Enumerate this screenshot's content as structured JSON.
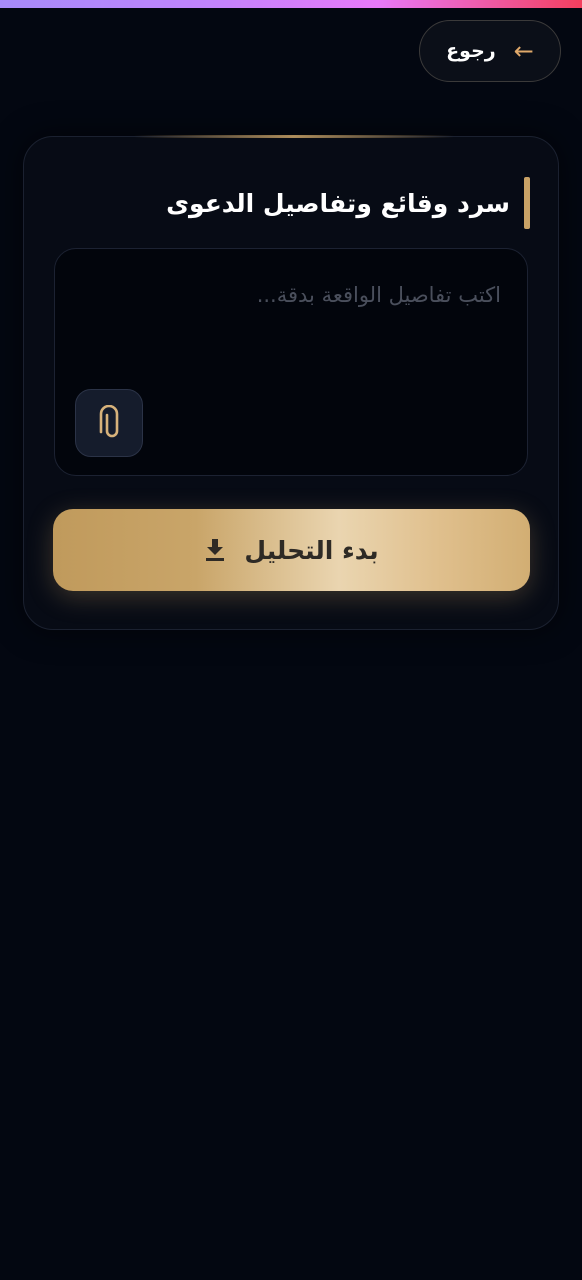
{
  "header": {
    "back_label": "رجوع",
    "back_icon": "arrow-left-icon"
  },
  "card": {
    "title": "سرد وقائع وتفاصيل الدعوى",
    "details_input": {
      "value": "",
      "placeholder": "اكتب تفاصيل الواقعة بدقة..."
    },
    "attach_icon": "paperclip-icon",
    "start_button": {
      "label": "بدء التحليل",
      "icon": "download-icon"
    }
  },
  "colors": {
    "background": "#030711",
    "card": "#070b15",
    "accent_gold": "#c9a266",
    "gradient_bar_start": "#a78bfa",
    "gradient_bar_end": "#f43f5e"
  }
}
